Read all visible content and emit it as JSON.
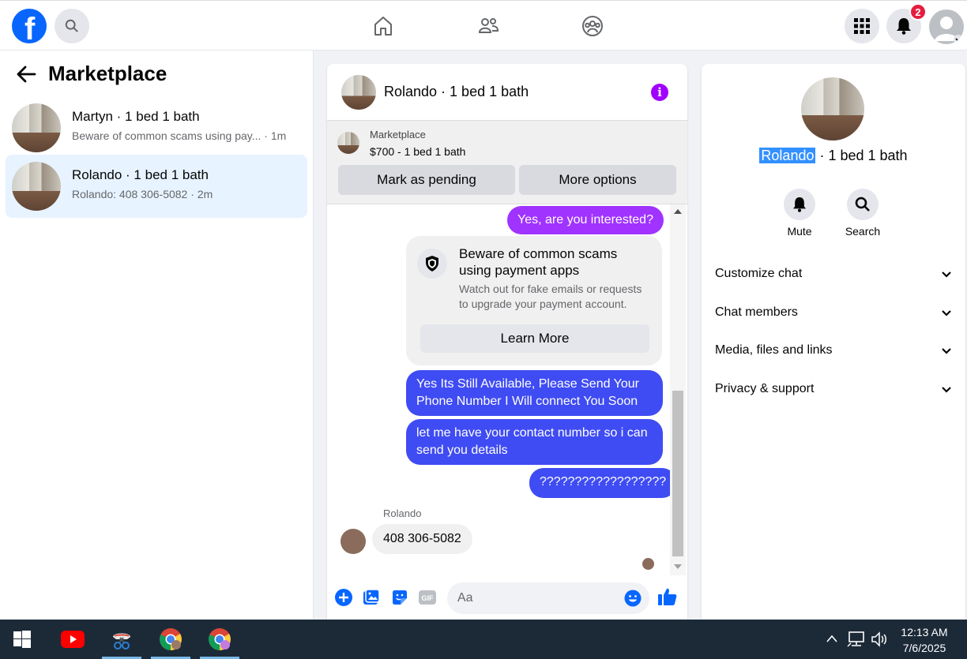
{
  "topbar": {
    "logo": "facebook-logo",
    "logo_letter": "f",
    "notification_count": "2",
    "icons": [
      "search-icon",
      "home-icon",
      "friends-icon",
      "groups-icon",
      "menu-grid-icon",
      "bell-icon",
      "account-avatar"
    ]
  },
  "left": {
    "title": "Marketplace",
    "conversations": [
      {
        "name": "Martyn · 1 bed 1 bath",
        "preview": "Beware of common scams using pay... · 1m"
      },
      {
        "name": "Rolando · 1 bed 1 bath",
        "preview": "Rolando: 408 306-5082 · 2m"
      }
    ]
  },
  "chat": {
    "title": "Rolando · 1 bed 1 bath",
    "marketplace_label": "Marketplace",
    "listing": "$700 - 1 bed 1 bath",
    "mark_pending": "Mark as pending",
    "more_options": "More options",
    "messages": {
      "m1": "Yes, are you interested?",
      "warn_title": "Beware of common scams using payment apps",
      "warn_body": "Watch out for fake emails or requests to upgrade your payment account.",
      "learn_more": "Learn More",
      "m2": "Yes Its Still Available, Please Send Your Phone Number I Will connect You Soon",
      "m3": "let me have your contact number so i can send you details",
      "m4": "??????????????????",
      "sender": "Rolando",
      "reply": "408 306-5082"
    },
    "composer_placeholder": "Aa"
  },
  "right": {
    "name_highlight": "Rolando",
    "name_rest": " · 1 bed 1 bath",
    "mute": "Mute",
    "search": "Search",
    "sections": [
      "Customize chat",
      "Chat members",
      "Media, files and links",
      "Privacy & support"
    ]
  },
  "taskbar": {
    "time": "12:13 AM",
    "date": "7/6/2025"
  },
  "colors": {
    "facebook_blue": "#0866ff",
    "purple_bubble": "#a033ff",
    "blue_bubble": "#3f4cf3",
    "active_conversation": "#e7f3ff"
  }
}
